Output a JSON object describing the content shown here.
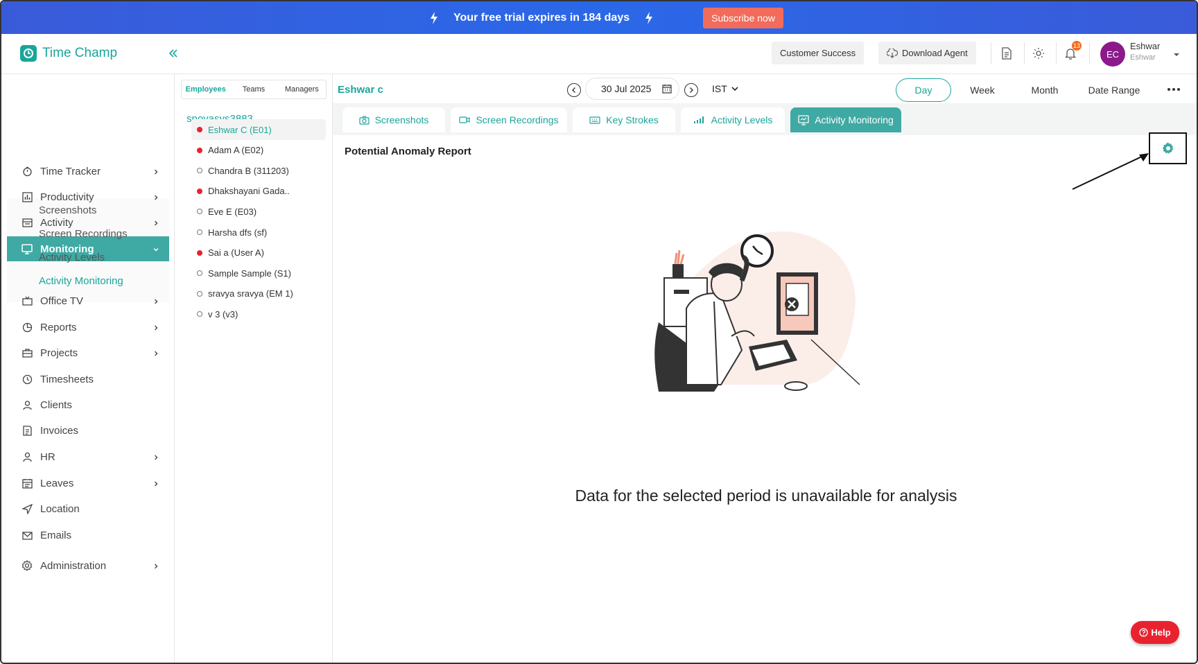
{
  "banner": {
    "text": "Your free trial expires in 184 days",
    "subscribe_label": "Subscribe now"
  },
  "header": {
    "app_name": "Time Champ",
    "customer_success_label": "Customer Success",
    "download_agent_label": "Download Agent",
    "notification_count": "13",
    "avatar_initials": "EC",
    "user_name": "Eshwar",
    "user_sub": "Eshwar"
  },
  "nav": {
    "items": [
      {
        "label": "Time Tracker",
        "icon": "stopwatch-icon",
        "chevron": true
      },
      {
        "label": "Productivity",
        "icon": "bar-chart-icon",
        "chevron": true
      },
      {
        "label": "Activity",
        "icon": "activity-icon",
        "chevron": true
      },
      {
        "label": "Monitoring",
        "icon": "monitor-icon",
        "chevron": true,
        "active": true
      },
      {
        "label": "Office TV",
        "icon": "tv-icon",
        "chevron": true
      },
      {
        "label": "Reports",
        "icon": "pie-chart-icon",
        "chevron": true
      },
      {
        "label": "Projects",
        "icon": "briefcase-icon",
        "chevron": true
      },
      {
        "label": "Timesheets",
        "icon": "clock-icon",
        "chevron": false
      },
      {
        "label": "Clients",
        "icon": "user-icon",
        "chevron": false
      },
      {
        "label": "Invoices",
        "icon": "invoice-icon",
        "chevron": false
      },
      {
        "label": "HR",
        "icon": "person-icon",
        "chevron": true
      },
      {
        "label": "Leaves",
        "icon": "calendar-icon",
        "chevron": true
      },
      {
        "label": "Location",
        "icon": "navigation-icon",
        "chevron": false
      },
      {
        "label": "Emails",
        "icon": "mail-icon",
        "chevron": false
      },
      {
        "label": "Administration",
        "icon": "gear-icon",
        "chevron": true
      }
    ],
    "monitoring_sub": [
      "Screenshots",
      "Screen Recordings",
      "Activity Levels",
      "Activity Monitoring"
    ]
  },
  "employees": {
    "tabs": [
      "Employees",
      "Teams",
      "Managers"
    ],
    "org": "snovasys3883",
    "list": [
      {
        "name": "Eshwar C (E01)",
        "status": "online"
      },
      {
        "name": "Adam A (E02)",
        "status": "online"
      },
      {
        "name": "Chandra B (311203)",
        "status": "offline"
      },
      {
        "name": "Dhakshayani Gada..",
        "status": "online"
      },
      {
        "name": "Eve E (E03)",
        "status": "offline"
      },
      {
        "name": "Harsha dfs (sf)",
        "status": "offline"
      },
      {
        "name": "Sai a (User A)",
        "status": "online"
      },
      {
        "name": "Sample Sample (S1)",
        "status": "offline"
      },
      {
        "name": "sravya sravya (EM 1)",
        "status": "offline"
      },
      {
        "name": "v 3 (v3)",
        "status": "offline"
      }
    ]
  },
  "main": {
    "employee_name": "Eshwar c",
    "date": "30 Jul 2025",
    "timezone": "IST",
    "range_tabs": [
      "Day",
      "Week",
      "Month",
      "Date Range"
    ],
    "monitoring_tabs": [
      "Screenshots",
      "Screen Recordings",
      "Key Strokes",
      "Activity Levels",
      "Activity Monitoring"
    ],
    "report_title": "Potential Anomaly Report",
    "empty_message": "Data for the selected period is unavailable for analysis",
    "help_label": "Help"
  },
  "colors": {
    "accent": "#1aa59a",
    "banner": "#2a68e8",
    "subscribe": "#f26b5b",
    "online": "#e8232f"
  }
}
